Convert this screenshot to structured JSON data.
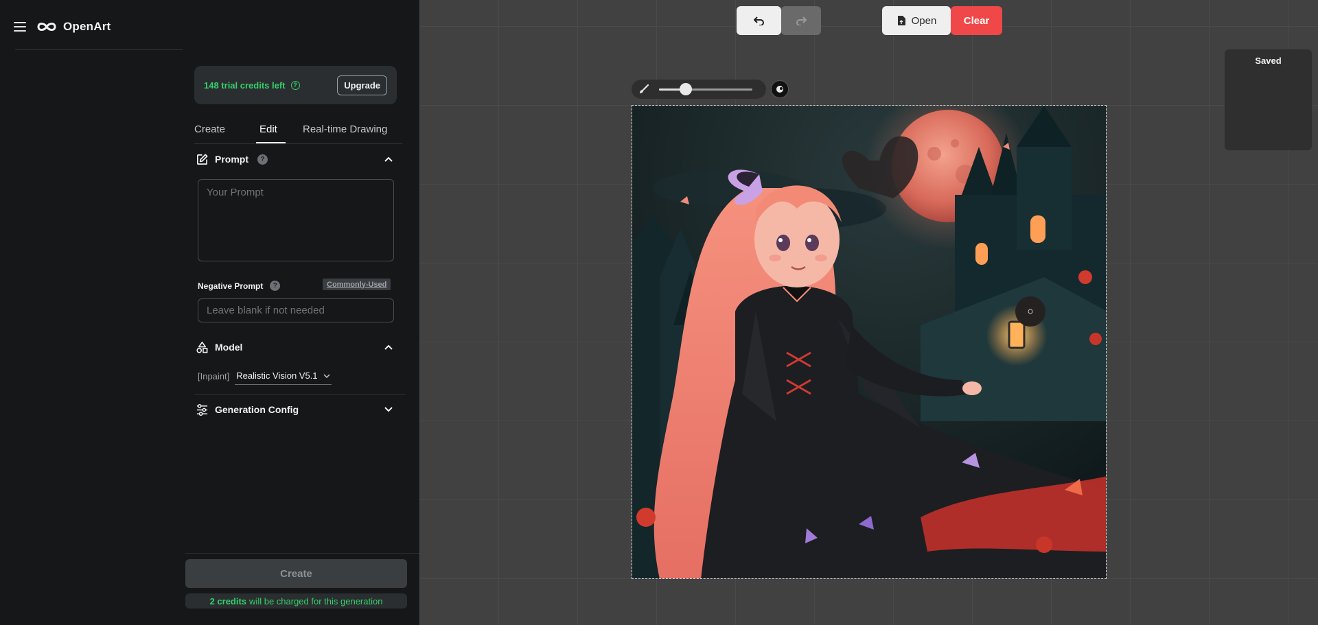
{
  "app": {
    "name": "OpenArt"
  },
  "credits": {
    "text": "148 trial credits left",
    "upgrade_label": "Upgrade"
  },
  "tabs": [
    {
      "label": "Create",
      "active": false
    },
    {
      "label": "Edit",
      "active": true
    },
    {
      "label": "Real-time Drawing",
      "active": false
    }
  ],
  "prompt": {
    "title": "Prompt",
    "placeholder": "Your Prompt",
    "value": "",
    "negative_label": "Negative Prompt",
    "commonly_used": "Commonly-Used",
    "negative_placeholder": "Leave blank if not needed",
    "negative_value": ""
  },
  "model": {
    "title": "Model",
    "tag": "[Inpaint]",
    "selected": "Realistic Vision V5.1"
  },
  "generation_config": {
    "title": "Generation Config",
    "expanded": false
  },
  "create": {
    "label": "Create",
    "credits_bold": "2 credits",
    "credits_rest": "will be charged for this generation"
  },
  "toolbar": {
    "open_label": "Open",
    "clear_label": "Clear",
    "redo_enabled": false
  },
  "brush": {
    "size_fraction": 0.29
  },
  "saved": {
    "label": "Saved"
  },
  "colors": {
    "accent_green": "#33d16a",
    "clear_red": "#f04848",
    "panel_bg": "#151718",
    "canvas_bg": "#414141"
  },
  "icons": {
    "menu": "hamburger-icon",
    "logo": "infinity-logo-icon",
    "help": "question-circle-icon",
    "prompt": "edit-square-icon",
    "model": "shapes-icon",
    "config": "sliders-icon",
    "undo": "undo-icon",
    "redo": "redo-icon",
    "open": "file-icon",
    "brush": "brush-icon"
  }
}
